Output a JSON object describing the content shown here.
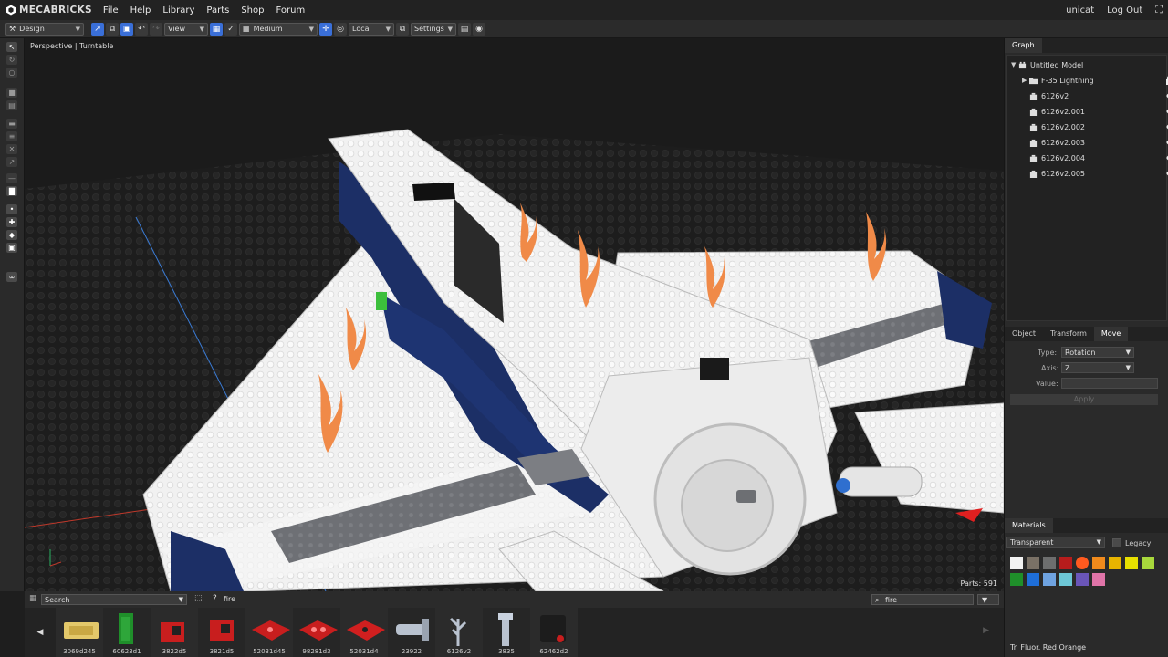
{
  "app": {
    "name": "MECABRICKS",
    "menu": [
      "File",
      "Help",
      "Library",
      "Parts",
      "Shop",
      "Forum"
    ],
    "user": "unicat",
    "logout": "Log Out",
    "fullscreen_icon": "fullscreen-icon"
  },
  "toolbar": {
    "mode": "Design",
    "view": "View",
    "quality": "Medium",
    "space": "Local",
    "settings": "Settings"
  },
  "viewport": {
    "label": "Perspective | Turntable",
    "parts_count": "Parts: 591"
  },
  "graph": {
    "tab": "Graph",
    "root": "Untitled Model",
    "items": [
      {
        "label": "F-35 Lightning",
        "group": true,
        "locked": true
      },
      {
        "label": "6126v2"
      },
      {
        "label": "6126v2.001"
      },
      {
        "label": "6126v2.002"
      },
      {
        "label": "6126v2.003"
      },
      {
        "label": "6126v2.004"
      },
      {
        "label": "6126v2.005"
      }
    ]
  },
  "object_panel": {
    "tabs": [
      "Object",
      "Transform",
      "Move"
    ],
    "active_tab": "Move",
    "type_label": "Type:",
    "type_value": "Rotation",
    "axis_label": "Axis:",
    "axis_value": "Z",
    "value_label": "Value:",
    "value_value": "",
    "apply": "Apply"
  },
  "materials": {
    "tab": "Materials",
    "filter": "Transparent",
    "legacy": "Legacy",
    "swatches": [
      "#f2f2f2",
      "#7a7166",
      "#6d6e6e",
      "#b71c1c",
      "#ff5a1f",
      "#f08a1c",
      "#e8b400",
      "#e8e000",
      "#a8d83c",
      "#1f8f2a",
      "#1e6ed8",
      "#6fa3e0",
      "#6dc7d6",
      "#6a55b8",
      "#e074a8"
    ],
    "selected": "Tr. Fluor. Red Orange"
  },
  "bottom": {
    "search_placeholder": "Search",
    "filter_text": "fire",
    "search_query": "fire",
    "parts": [
      "3069d245",
      "60623d1",
      "3822d5",
      "3821d5",
      "52031d45",
      "98281d3",
      "52031d4",
      "23922",
      "6126v2",
      "3835",
      "62462d2"
    ]
  }
}
